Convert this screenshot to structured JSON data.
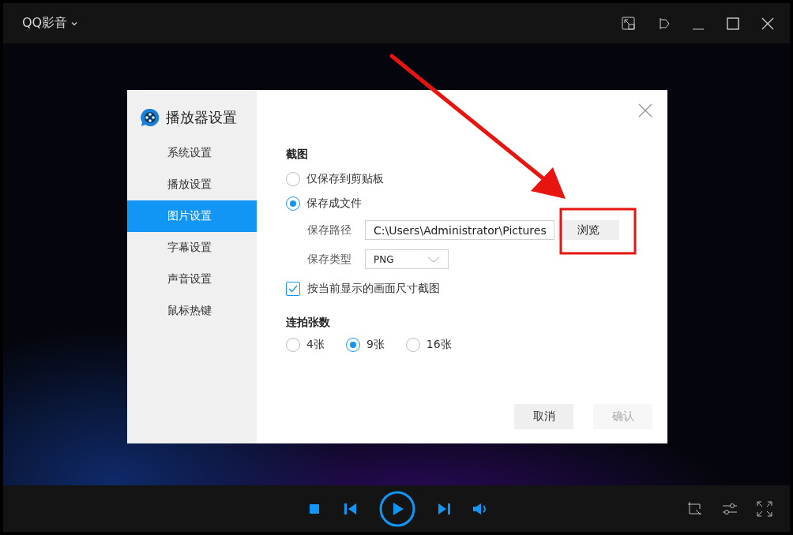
{
  "app": {
    "title": "QQ影音"
  },
  "dialog": {
    "title": "播放器设置",
    "nav": [
      {
        "label": "系统设置",
        "selected": false
      },
      {
        "label": "播放设置",
        "selected": false
      },
      {
        "label": "图片设置",
        "selected": true
      },
      {
        "label": "字幕设置",
        "selected": false
      },
      {
        "label": "声音设置",
        "selected": false
      },
      {
        "label": "鼠标热键",
        "selected": false
      }
    ],
    "screenshot": {
      "title": "截图",
      "options": [
        {
          "label": "仅保存到剪贴板",
          "selected": false
        },
        {
          "label": "保存成文件",
          "selected": true
        }
      ],
      "path": {
        "label": "保存路径",
        "value": "C:\\Users\\Administrator\\Pictures",
        "browse": "浏览"
      },
      "format": {
        "label": "保存类型",
        "value": "PNG"
      },
      "keep_size": {
        "label": "按当前显示的画面尺寸截图",
        "checked": true
      }
    },
    "burst": {
      "title": "连拍张数",
      "options": [
        {
          "label": "4张",
          "selected": false
        },
        {
          "label": "9张",
          "selected": true
        },
        {
          "label": "16张",
          "selected": false
        }
      ]
    },
    "buttons": [
      {
        "label": "取消",
        "disabled": false
      },
      {
        "label": "确认",
        "disabled": true
      }
    ]
  }
}
